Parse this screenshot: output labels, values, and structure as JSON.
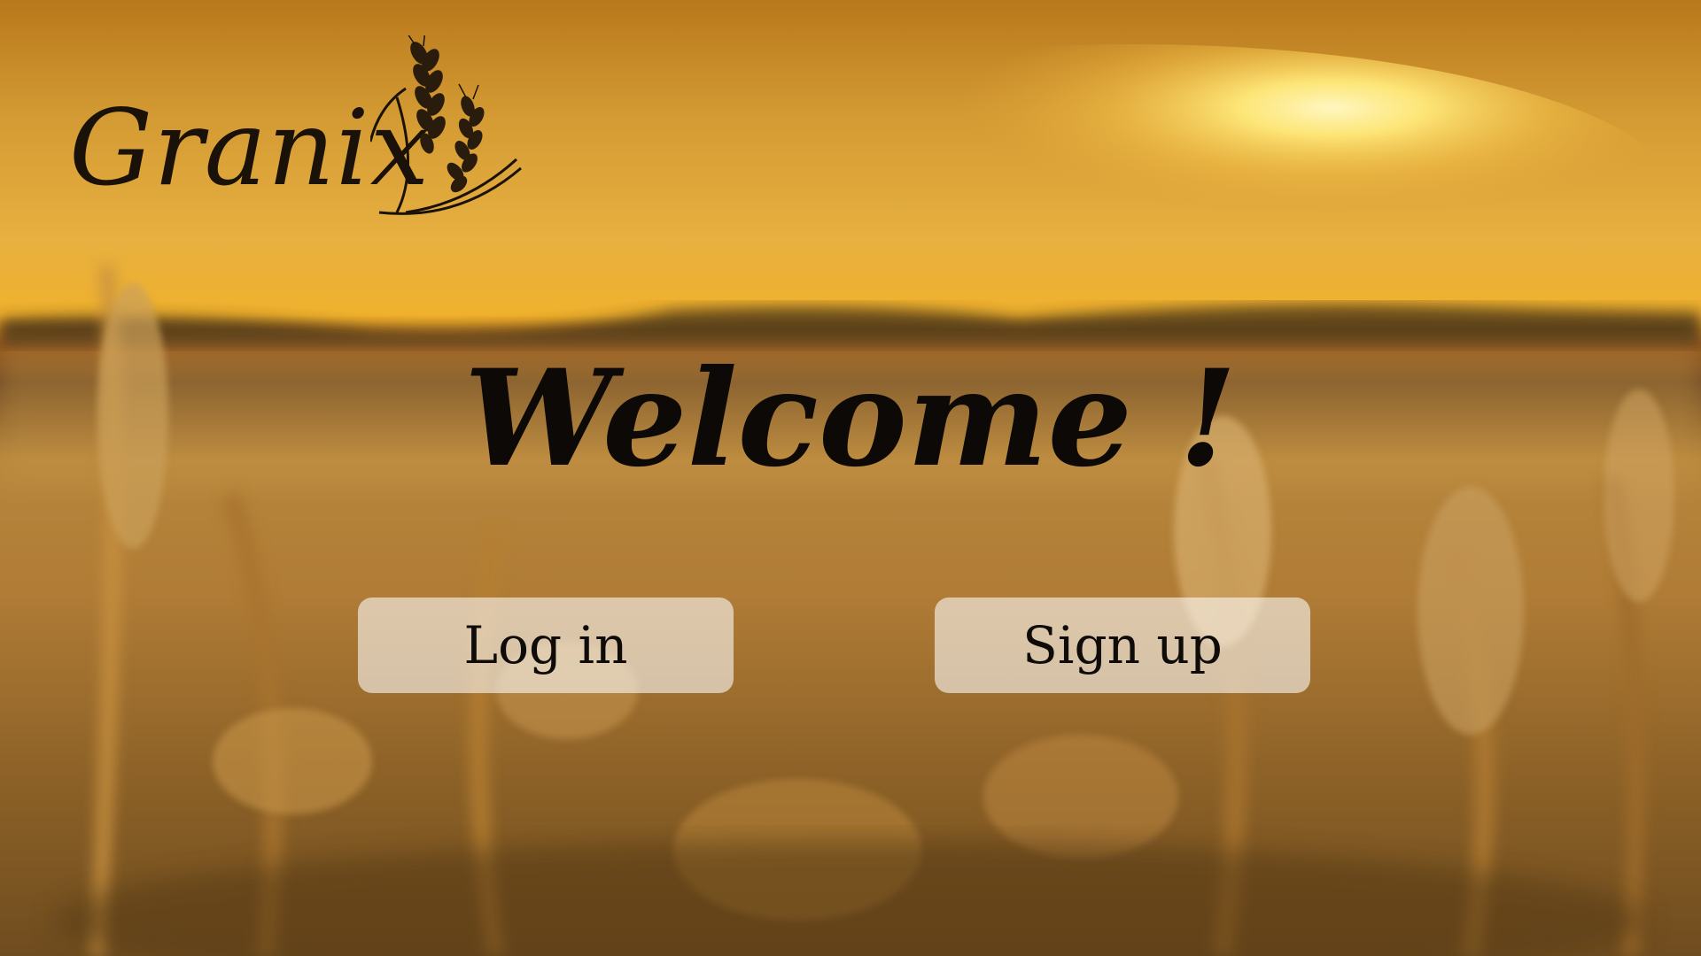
{
  "brand": {
    "name": "Granix",
    "logo_icon": "wheat-icon"
  },
  "hero": {
    "title": "Welcome !"
  },
  "actions": {
    "login_label": "Log in",
    "signup_label": "Sign up"
  },
  "colors": {
    "sky_top": "#b8781c",
    "sun_glow": "#fff2a8",
    "field": "#b9853a",
    "text_dark": "#0c0906",
    "button_fill": "rgba(255,255,255,0.58)"
  }
}
